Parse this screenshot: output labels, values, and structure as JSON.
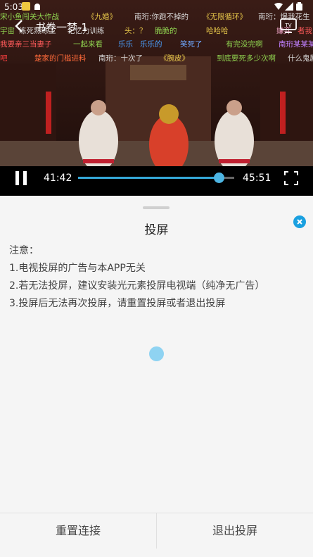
{
  "status_bar": {
    "time": "5:03"
  },
  "danmaku": [
    {
      "text": "宋小鱼闯关大作战",
      "color": "#8fd14f"
    },
    {
      "text": "《九婚》",
      "color": "#e8c84a"
    },
    {
      "text": "南珩:你跑不掉的",
      "color": "#d8d8d8"
    },
    {
      "text": "《无限循环》",
      "color": "#e8c84a"
    },
    {
      "text": "南珩：爆我花生",
      "color": "#d8d8d8"
    },
    {
      "text": "宇宙",
      "color": "#8fd14f"
    },
    {
      "text": "练死熟练工",
      "color": "#d8d8d8"
    },
    {
      "text": "记忆力训练",
      "color": "#d8d8d8"
    },
    {
      "text": "头：？",
      "color": "#e8c84a"
    },
    {
      "text": "脆脆的",
      "color": "#8fd14f"
    },
    {
      "text": "哈哈哈",
      "color": "#e8c84a"
    },
    {
      "text": "嫌弃",
      "color": "#e8a0c0"
    },
    {
      "text": "者我",
      "color": "#ff5a5a"
    },
    {
      "text": "我要亲三当妻子",
      "color": "#ff5a5a"
    },
    {
      "text": "一起来看",
      "color": "#8fd14f"
    },
    {
      "text": "乐乐",
      "color": "#4aa0ff"
    },
    {
      "text": "乐乐的",
      "color": "#4aa0ff"
    },
    {
      "text": "笑死了",
      "color": "#6fa8ff"
    },
    {
      "text": "有完没完啊",
      "color": "#8fd14f"
    },
    {
      "text": "南珩某某某",
      "color": "#c080ff"
    },
    {
      "text": "吧",
      "color": "#ff4040"
    },
    {
      "text": "楚家的门槛进料",
      "color": "#ff6a3a"
    },
    {
      "text": "南珩：十次了",
      "color": "#d8d8d8"
    },
    {
      "text": "《腕皮》",
      "color": "#e8c84a"
    },
    {
      "text": "到底要死多少次啊",
      "color": "#8fd14f"
    },
    {
      "text": "什么鬼剧",
      "color": "#d8d8d8"
    }
  ],
  "topbar": {
    "title": "书卷一梦-1"
  },
  "player": {
    "current_time": "41:42",
    "duration": "45:51",
    "progress": 0.9
  },
  "sheet": {
    "title": "投屏",
    "notes": [
      "注意：",
      "1.电视投屏的广告与本APP无关",
      "2.若无法投屏，建议安装光元素投屏电视端（纯净无广告）",
      "3.投屏后无法再次投屏，请重置投屏或者退出投屏"
    ],
    "reset_button": "重置连接",
    "exit_button": "退出投屏"
  },
  "colors": {
    "accent": "#1aa0e0",
    "progress": "#35a8d8"
  }
}
